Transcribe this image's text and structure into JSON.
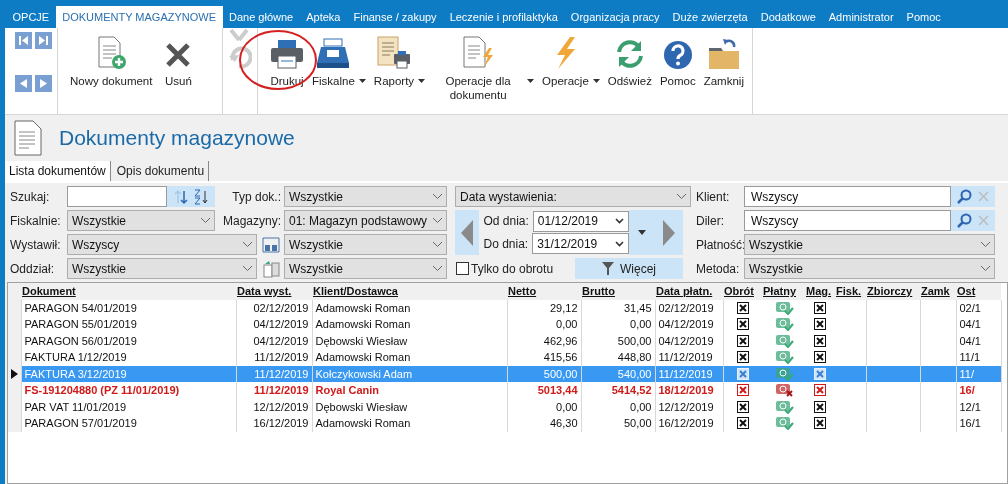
{
  "top_tabs": [
    {
      "label": "OPCJE",
      "selected": false
    },
    {
      "label": "DOKUMENTY MAGAZYNOWE",
      "selected": true
    },
    {
      "label": "Dane główne",
      "selected": false
    },
    {
      "label": "Apteka",
      "selected": false
    },
    {
      "label": "Finanse / zakupy",
      "selected": false
    },
    {
      "label": "Leczenie i profilaktyka",
      "selected": false
    },
    {
      "label": "Organizacja pracy",
      "selected": false
    },
    {
      "label": "Duże zwierzęta",
      "selected": false
    },
    {
      "label": "Dodatkowe",
      "selected": false
    },
    {
      "label": "Administrator",
      "selected": false
    },
    {
      "label": "Pomoc",
      "selected": false
    }
  ],
  "ribbon": {
    "groups": [
      {
        "buttons": [
          {
            "label": "Nowy dokument",
            "dropdown": false,
            "disabled": false
          },
          {
            "label": "Usuń",
            "dropdown": false,
            "disabled": false
          }
        ]
      },
      {
        "buttons": [
          {
            "dropdown": false,
            "disabled": true
          }
        ]
      },
      {
        "buttons": [
          {
            "label": "Drukuj",
            "dropdown": false,
            "disabled": false
          },
          {
            "label": "Fiskalne",
            "dropdown": true,
            "disabled": false
          },
          {
            "label": "Raporty",
            "dropdown": true,
            "disabled": false
          },
          {
            "label": "Operacje dla dokumentu",
            "dropdown": true,
            "disabled": false
          },
          {
            "label": "Operacje",
            "dropdown": true,
            "disabled": false
          },
          {
            "label": "Odśwież",
            "dropdown": false,
            "disabled": false
          },
          {
            "label": "Pomoc",
            "dropdown": false,
            "disabled": false
          },
          {
            "label": "Zamknij",
            "dropdown": false,
            "disabled": false
          }
        ]
      }
    ]
  },
  "page_title": "Dokumenty magazynowe",
  "view_tabs": [
    {
      "label": "Lista dokumentów",
      "selected": true
    },
    {
      "label": "Opis dokumentu",
      "selected": false
    }
  ],
  "filters": {
    "search": {
      "label": "Szukaj:"
    },
    "doc_type": {
      "label": "Typ dok.:",
      "value": "Wszystkie"
    },
    "date_field": {
      "value": "Data wystawienia:"
    },
    "client": {
      "label": "Klient:",
      "value": "Wszyscy"
    },
    "fiscal": {
      "label": "Fiskalnie:",
      "value": "Wszystkie"
    },
    "warehouse": {
      "label": "Magazyny:",
      "value": "01: Magazyn podstawowy"
    },
    "date_from": {
      "label": "Od dnia:",
      "value": "01/12/2019"
    },
    "dealer": {
      "label": "Diler:",
      "value": "Wszyscy"
    },
    "issuer": {
      "label": "Wystawił:",
      "value": "Wszyscy"
    },
    "filter_a": {
      "value": "Wszystkie"
    },
    "date_to": {
      "label": "Do dnia:",
      "value": "31/12/2019"
    },
    "payment": {
      "label": "Płatność:",
      "value": "Wszystkie"
    },
    "branch": {
      "label": "Oddział:",
      "value": "Wszystkie"
    },
    "filter_b": {
      "value": "Wszystkie"
    },
    "turnover_only": {
      "label": "Tylko do obrotu",
      "checked": false
    },
    "more_button": "Więcej",
    "method": {
      "label": "Metoda:",
      "value": "Wszystkie"
    }
  },
  "table": {
    "columns": [
      "Dokument",
      "Data wyst.",
      "Klient/Dostawca",
      "Netto",
      "Brutto",
      "Data płatn.",
      "Obrót",
      "Płatny",
      "Mag.",
      "Fisk.",
      "Zbiorczy",
      "Zamk",
      "Ost"
    ],
    "rows": [
      {
        "document": "PARAGON 54/01/2019",
        "issue_date": "02/12/2019",
        "client": "Adamowski Roman",
        "net": "29,12",
        "gross": "31,45",
        "payment_date": "02/12/2019",
        "column_13": "02/1",
        "selected": false,
        "error": false
      },
      {
        "document": "PARAGON 55/01/2019",
        "issue_date": "04/12/2019",
        "client": "Adamowski Roman",
        "net": "0,00",
        "gross": "0,00",
        "payment_date": "04/12/2019",
        "column_13": "04/1",
        "selected": false,
        "error": false
      },
      {
        "document": "PARAGON 56/01/2019",
        "issue_date": "04/12/2019",
        "client": "Dębowski Wiesław",
        "net": "462,96",
        "gross": "500,00",
        "payment_date": "04/12/2019",
        "column_13": "04/1",
        "selected": false,
        "error": false
      },
      {
        "document": "FAKTURA 1/12/2019",
        "issue_date": "11/12/2019",
        "client": "Adamowski Roman",
        "net": "415,56",
        "gross": "448,80",
        "payment_date": "11/12/2019",
        "column_13": "11/1",
        "selected": false,
        "error": false
      },
      {
        "document": "FAKTURA 3/12/2019",
        "issue_date": "11/12/2019",
        "client": "Kołczykowski Adam",
        "net": "500,00",
        "gross": "540,00",
        "payment_date": "11/12/2019",
        "column_13": "11/",
        "selected": true,
        "error": false
      },
      {
        "document": "FS-191204880 (PZ 11/01/2019)",
        "issue_date": "11/12/2019",
        "client": "Royal Canin",
        "net": "5013,44",
        "gross": "5414,52",
        "payment_date": "18/12/2019",
        "column_13": "16/",
        "selected": false,
        "error": true
      },
      {
        "document": "PAR VAT 11/01/2019",
        "issue_date": "12/12/2019",
        "client": "Dębowski Wiesław",
        "net": "0,00",
        "gross": "0,00",
        "payment_date": "12/12/2019",
        "column_13": "12/1",
        "selected": false,
        "error": false
      },
      {
        "document": "PARAGON 57/01/2019",
        "issue_date": "16/12/2019",
        "client": "Adamowski Roman",
        "net": "46,30",
        "gross": "50,00",
        "payment_date": "16/12/2019",
        "column_13": "16/1",
        "selected": false,
        "error": false
      }
    ]
  }
}
